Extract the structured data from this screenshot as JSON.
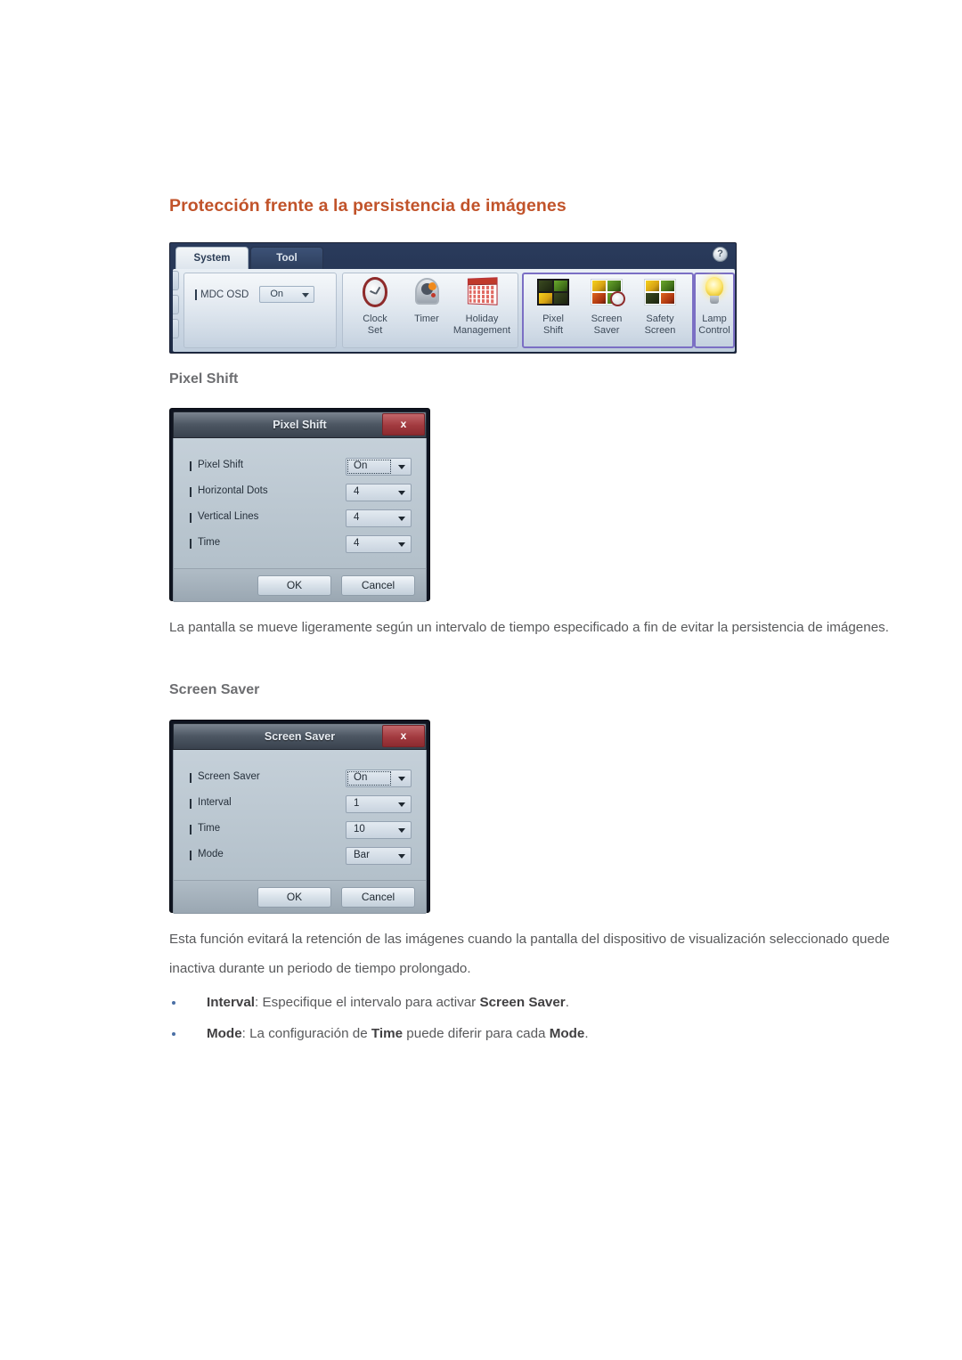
{
  "page": {
    "heading": "Protección frente a la persistencia de imágenes",
    "heading_color": "#c1532a"
  },
  "ribbon": {
    "tabs": [
      {
        "label": "System",
        "active": true
      },
      {
        "label": "Tool",
        "active": false
      }
    ],
    "help_icon": "?",
    "osd": {
      "label": "MDC OSD",
      "value": "On"
    },
    "groups": [
      {
        "name": "time",
        "icons": [
          {
            "icon": "clock-icon",
            "line1": "Clock",
            "line2": "Set"
          },
          {
            "icon": "timer-icon",
            "line1": "Timer",
            "line2": ""
          },
          {
            "icon": "calendar-icon",
            "line1": "Holiday",
            "line2": "Management"
          }
        ]
      },
      {
        "name": "protection",
        "highlighted": true,
        "icons": [
          {
            "icon": "pixel-shift-icon",
            "line1": "Pixel",
            "line2": "Shift"
          },
          {
            "icon": "screen-saver-icon",
            "line1": "Screen",
            "line2": "Saver"
          },
          {
            "icon": "safety-screen-icon",
            "line1": "Safety",
            "line2": "Screen"
          }
        ]
      },
      {
        "name": "lamp",
        "highlighted": true,
        "icons": [
          {
            "icon": "lamp-icon",
            "line1": "Lamp",
            "line2": "Control"
          }
        ]
      }
    ]
  },
  "pixel_shift": {
    "section_heading": "Pixel Shift",
    "dialog": {
      "title": "Pixel Shift",
      "close_label": "x",
      "rows": [
        {
          "label": "Pixel Shift",
          "value": "On",
          "focused": true
        },
        {
          "label": "Horizontal Dots",
          "value": "4",
          "focused": false
        },
        {
          "label": "Vertical Lines",
          "value": "4",
          "focused": false
        },
        {
          "label": "Time",
          "value": "4",
          "focused": false
        }
      ],
      "ok_label": "OK",
      "cancel_label": "Cancel"
    },
    "description": "La pantalla se mueve ligeramente según un intervalo de tiempo especificado a fin de evitar la persistencia de imágenes."
  },
  "screen_saver": {
    "section_heading": "Screen Saver",
    "dialog": {
      "title": "Screen Saver",
      "close_label": "x",
      "rows": [
        {
          "label": "Screen Saver",
          "value": "On",
          "focused": true
        },
        {
          "label": "Interval",
          "value": "1",
          "focused": false
        },
        {
          "label": "Time",
          "value": "10",
          "focused": false
        },
        {
          "label": "Mode",
          "value": "Bar",
          "focused": false
        }
      ],
      "ok_label": "OK",
      "cancel_label": "Cancel"
    },
    "description": "Esta función evitará la retención de las imágenes cuando la pantalla del dispositivo de visualización seleccionado quede inactiva durante un periodo de tiempo prolongado.",
    "bullets": [
      {
        "parts": [
          {
            "text": "Interval",
            "bold": true
          },
          {
            "text": ": Especifique el intervalo para activar ",
            "bold": false
          },
          {
            "text": "Screen Saver",
            "bold": true
          },
          {
            "text": ".",
            "bold": false
          }
        ]
      },
      {
        "parts": [
          {
            "text": "Mode",
            "bold": true
          },
          {
            "text": ": La configuración de ",
            "bold": false
          },
          {
            "text": "Time",
            "bold": true
          },
          {
            "text": " puede diferir para cada ",
            "bold": false
          },
          {
            "text": "Mode",
            "bold": true
          },
          {
            "text": ".",
            "bold": false
          }
        ]
      }
    ]
  }
}
